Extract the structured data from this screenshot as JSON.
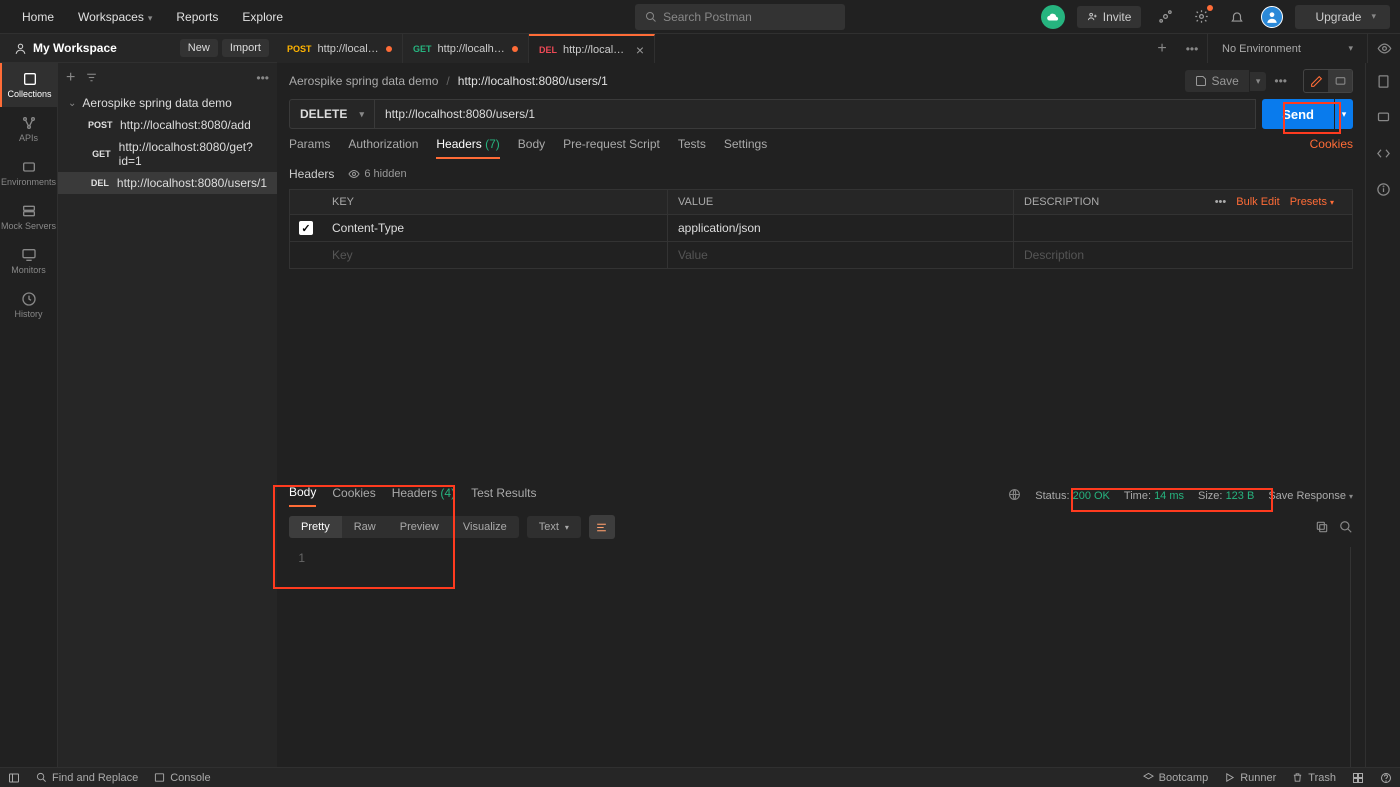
{
  "header": {
    "home": "Home",
    "workspaces": "Workspaces",
    "reports": "Reports",
    "explore": "Explore",
    "search_placeholder": "Search Postman",
    "invite": "Invite",
    "upgrade": "Upgrade"
  },
  "workspace": {
    "name": "My Workspace",
    "new_btn": "New",
    "import_btn": "Import"
  },
  "rail": {
    "collections": "Collections",
    "apis": "APIs",
    "environments": "Environments",
    "mock": "Mock Servers",
    "monitors": "Monitors",
    "history": "History"
  },
  "sidebar": {
    "collection_name": "Aerospike spring data demo",
    "items": [
      {
        "method": "POST",
        "method_class": "method-post",
        "url": "http://localhost:8080/add",
        "active": false
      },
      {
        "method": "GET",
        "method_class": "method-get",
        "url": "http://localhost:8080/get?id=1",
        "active": false
      },
      {
        "method": "DEL",
        "method_class": "method-del",
        "url": "http://localhost:8080/users/1",
        "active": true
      }
    ]
  },
  "tabs": [
    {
      "method": "POST",
      "method_class": "method-post",
      "title": "http://localhost:80...",
      "dirty": true,
      "active": false
    },
    {
      "method": "GET",
      "method_class": "method-get",
      "title": "http://localhost:80...",
      "dirty": true,
      "active": false
    },
    {
      "method": "DEL",
      "method_class": "method-del",
      "title": "http://localhost:80...",
      "dirty": false,
      "active": true,
      "closable": true
    }
  ],
  "env": {
    "selected": "No Environment"
  },
  "breadcrumb": {
    "collection": "Aerospike spring data demo",
    "request": "http://localhost:8080/users/1",
    "save": "Save"
  },
  "request": {
    "method": "DELETE",
    "url": "http://localhost:8080/users/1",
    "send": "Send",
    "param_tabs": {
      "params": "Params",
      "auth": "Authorization",
      "headers": "Headers",
      "headers_count": "(7)",
      "body": "Body",
      "prereq": "Pre-request Script",
      "tests": "Tests",
      "settings": "Settings",
      "cookies": "Cookies"
    },
    "headers_label": "Headers",
    "hidden_count": "6 hidden",
    "table": {
      "key_h": "KEY",
      "value_h": "VALUE",
      "desc_h": "DESCRIPTION",
      "more": "•••",
      "bulk": "Bulk Edit",
      "presets": "Presets",
      "rows": [
        {
          "key": "Content-Type",
          "value": "application/json",
          "desc": ""
        }
      ],
      "empty": {
        "key": "Key",
        "value": "Value",
        "desc": "Description"
      }
    }
  },
  "response": {
    "tabs": {
      "body": "Body",
      "cookies": "Cookies",
      "headers": "Headers",
      "headers_count": "(4)",
      "tests": "Test Results"
    },
    "status_label": "Status:",
    "status_code": "200 OK",
    "time_label": "Time:",
    "time_value": "14 ms",
    "size_label": "Size:",
    "size_value": "123 B",
    "save": "Save Response",
    "views": {
      "pretty": "Pretty",
      "raw": "Raw",
      "preview": "Preview",
      "visualize": "Visualize"
    },
    "type": "Text",
    "body_lines": [
      ""
    ]
  },
  "footer": {
    "find": "Find and Replace",
    "console": "Console",
    "bootcamp": "Bootcamp",
    "runner": "Runner",
    "trash": "Trash"
  }
}
